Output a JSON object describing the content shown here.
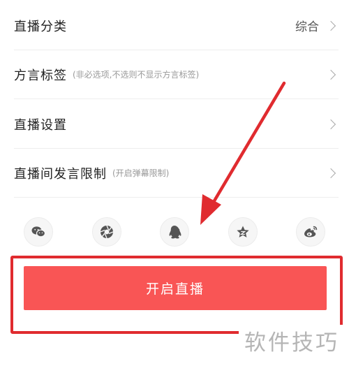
{
  "settings": {
    "category": {
      "label": "直播分类",
      "value": "综合"
    },
    "dialect": {
      "label": "方言标签",
      "hint": "(非必选项,不选则不显示方言标签)"
    },
    "live_settings": {
      "label": "直播设置"
    },
    "chat_limit": {
      "label": "直播间发言限制",
      "hint": "(开启弹幕限制)"
    }
  },
  "share": {
    "icons": [
      "wechat-icon",
      "moments-icon",
      "qq-icon",
      "qzone-icon",
      "weibo-icon"
    ]
  },
  "start_button": {
    "label": "开启直播"
  },
  "watermark": {
    "text": "软件技巧"
  },
  "colors": {
    "primary": "#f95555",
    "annotation": "#e02b2f",
    "hint": "#999999"
  }
}
